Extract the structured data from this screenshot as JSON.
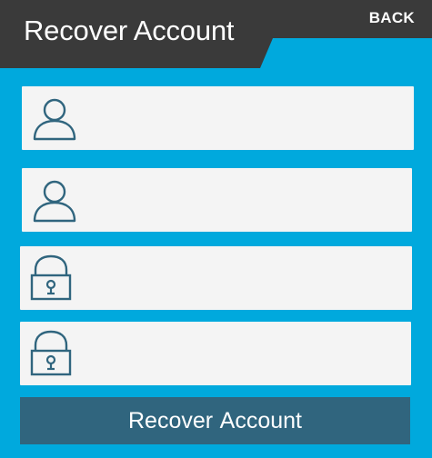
{
  "header": {
    "title": "Recover Account",
    "back_label": "BACK",
    "bar_color": "#3a3a3a"
  },
  "form": {
    "fields": [
      {
        "icon": "user-icon",
        "value": "",
        "placeholder": ""
      },
      {
        "icon": "user-icon",
        "value": "",
        "placeholder": ""
      },
      {
        "icon": "lock-icon",
        "value": "",
        "placeholder": ""
      },
      {
        "icon": "lock-icon",
        "value": "",
        "placeholder": ""
      }
    ],
    "submit_label": "Recover Account"
  },
  "colors": {
    "background": "#00a9dd",
    "header": "#3a3a3a",
    "field_background": "#f4f4f4",
    "icon_stroke": "#30657e",
    "button": "#30657e",
    "text_light": "#ffffff"
  }
}
